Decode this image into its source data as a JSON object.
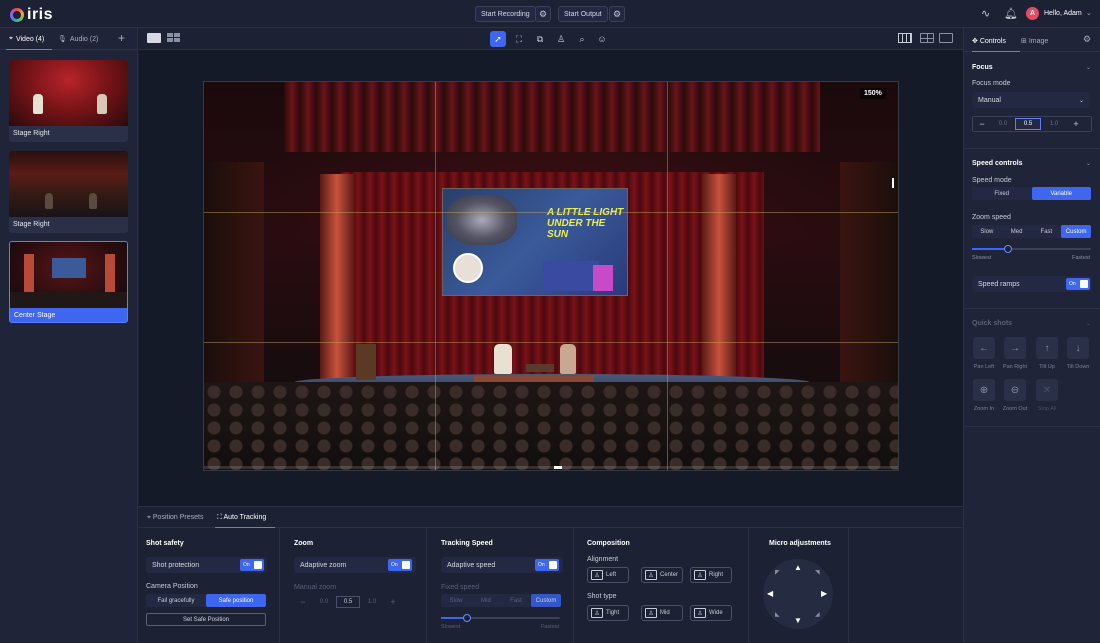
{
  "app": {
    "logo": "iris"
  },
  "header": {
    "start_recording": "Start Recording",
    "start_output": "Start Output",
    "avatar_initial": "A",
    "greeting": "Hello, Adam"
  },
  "left": {
    "tabs": [
      {
        "label": "Video (4)"
      },
      {
        "label": "Audio (2)"
      }
    ],
    "add": "+",
    "sources": [
      {
        "label": "Stage Right"
      },
      {
        "label": "Stage Right"
      },
      {
        "label": "Center Stage"
      }
    ]
  },
  "viewport": {
    "zoom": "150%",
    "screen_title": "A LITTLE LIGHT UNDER THE SUN"
  },
  "bottom": {
    "tabs": [
      {
        "label": "Position Presets"
      },
      {
        "label": "Auto Tracking"
      }
    ],
    "shot_safety": {
      "title": "Shot safety",
      "protection_label": "Shot protection",
      "toggle": "On",
      "camera_position_label": "Camera Position",
      "options": [
        "Fail gracefully",
        "Safe position"
      ],
      "set_button": "Set Safe Position"
    },
    "zoom": {
      "title": "Zoom",
      "adaptive_label": "Adaptive zoom",
      "toggle": "On",
      "manual_label": "Manual zoom",
      "stepper": [
        "0.0",
        "0.5",
        "1.0"
      ]
    },
    "tracking": {
      "title": "Tracking Speed",
      "adaptive_label": "Adaptive speed",
      "toggle": "On",
      "fixed_label": "Fixed speed",
      "options": [
        "Slow",
        "Mid",
        "Fast",
        "Custom"
      ],
      "slider_min": "Slowest",
      "slider_max": "Fastest",
      "slider_value": 0.22
    },
    "composition": {
      "title": "Composition",
      "alignment_label": "Alignment",
      "alignment": [
        "Left",
        "Center",
        "Right"
      ],
      "shot_type_label": "Shot type",
      "shot_types": [
        "Tight",
        "Mid",
        "Wide"
      ]
    },
    "micro": {
      "title": "Micro adjustments"
    }
  },
  "right": {
    "tabs": [
      {
        "label": "Controls"
      },
      {
        "label": "Image"
      }
    ],
    "focus": {
      "title": "Focus",
      "mode_label": "Focus mode",
      "mode_value": "Manual",
      "stepper": [
        "0.0",
        "0.5",
        "1.0"
      ]
    },
    "speed": {
      "title": "Speed controls",
      "mode_label": "Speed mode",
      "mode_options": [
        "Fixed",
        "Variable"
      ],
      "zoom_label": "Zoom speed",
      "zoom_options": [
        "Slow",
        "Med",
        "Fast",
        "Custom"
      ],
      "slider_min": "Slowest",
      "slider_max": "Fastest",
      "slider_value": 0.3,
      "ramps_label": "Speed ramps",
      "toggle": "On"
    },
    "quick_shots": {
      "title": "Quick shots",
      "items": [
        {
          "label": "Pan Left",
          "icon": "arrow-left-icon"
        },
        {
          "label": "Pan Right",
          "icon": "arrow-right-icon"
        },
        {
          "label": "Tilt Up",
          "icon": "arrow-up-icon"
        },
        {
          "label": "Tilt Down",
          "icon": "arrow-down-icon"
        },
        {
          "label": "Zoom In",
          "icon": "zoom-in-icon"
        },
        {
          "label": "Zoom Out",
          "icon": "zoom-out-icon"
        },
        {
          "label": "Stop All",
          "icon": "close-icon"
        }
      ]
    }
  },
  "colors": {
    "accent": "#3f66f0",
    "background": "#1c2133",
    "panel": "#1f2438"
  }
}
